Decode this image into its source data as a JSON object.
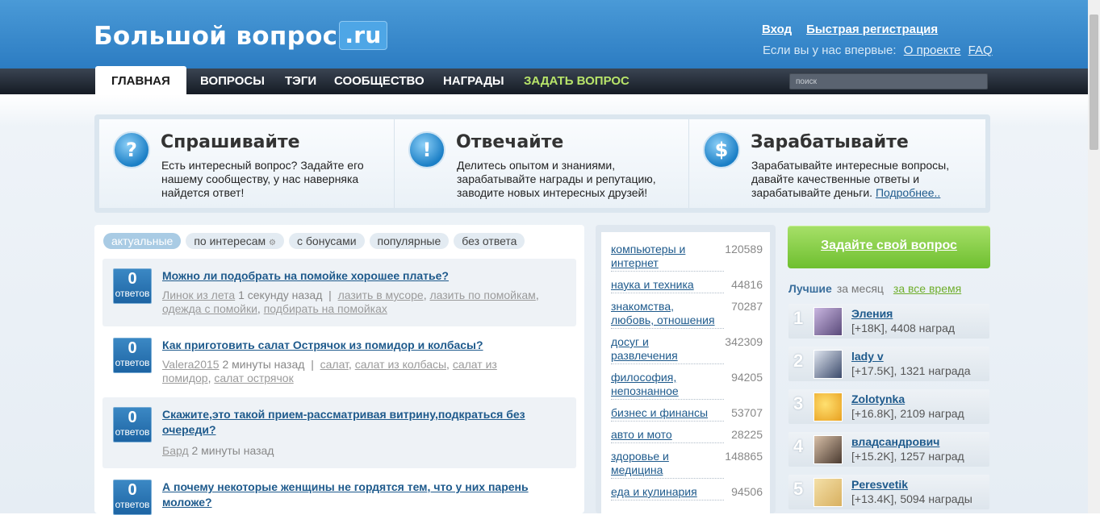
{
  "header": {
    "logo_text": "Большой вопрос",
    "logo_tld": ".ru",
    "login": "Вход",
    "register": "Быстрая регистрация",
    "first_time_text": "Если вы у нас впервые:",
    "about": "О проекте",
    "faq": "FAQ"
  },
  "nav": {
    "items": [
      "ГЛАВНАЯ",
      "ВОПРОСЫ",
      "ТЭГИ",
      "СООБЩЕСТВО",
      "НАГРАДЫ",
      "ЗАДАТЬ ВОПРОС"
    ],
    "search_placeholder": "поиск"
  },
  "promo": [
    {
      "icon": "?",
      "title": "Спрашивайте",
      "lines": [
        "Есть интересный вопрос? Задайте его",
        "нашему сообществу, у нас наверняка",
        "найдется ответ!"
      ]
    },
    {
      "icon": "!",
      "title": "Отвечайте",
      "lines": [
        "Делитесь опытом и знаниями,",
        "зарабатывайте награды и репутацию,",
        "заводите новых интересных друзей!"
      ]
    },
    {
      "icon": "$",
      "title": "Зарабатывайте",
      "lines": [
        "Зарабатывайте интересные вопросы,",
        "давайте качественные ответы и",
        "зарабатывайте деньги."
      ],
      "more": "Подробнее.."
    }
  ],
  "filters": [
    "актуальные",
    "по интересам",
    "с бонусами",
    "популярные",
    "без ответа"
  ],
  "questions": [
    {
      "answers": "0",
      "answers_label": "ответов",
      "title": "Можно ли подобрать на помойке хорошее платье?",
      "meta_line1": {
        "author": "Линок из лета",
        "time": "1 секунду назад",
        "tags": [
          "лазить в мусоре",
          "лазить по помойкам"
        ]
      },
      "meta_line2_tags": [
        "одежда с помойки",
        "подбирать на помойках"
      ]
    },
    {
      "answers": "0",
      "answers_label": "ответов",
      "title": "Как приготовить салат Острячок из помидор и колбасы?",
      "meta_line1": {
        "author": "Valera2015",
        "time": "2 минуты назад",
        "tags": [
          "салат",
          "салат из колбасы",
          "салат из"
        ]
      },
      "meta_line2_tags": [
        "помидор",
        "салат острячок"
      ]
    },
    {
      "answers": "0",
      "answers_label": "ответов",
      "title_line1": "Скажите,это такой прием-рассматривая витрину,подкраться без",
      "title_line2": "очереди?",
      "meta": {
        "author": "Бард",
        "time": "2 минуты назад"
      }
    },
    {
      "answers": "0",
      "answers_label": "ответов",
      "title_line1": "А почему некоторые женщины не гордятся тем, что у них парень",
      "title_line2": "моложе?"
    }
  ],
  "categories": [
    {
      "lines": [
        "компьютеры и",
        "интернет"
      ],
      "count": "120589"
    },
    {
      "lines": [
        "наука и техника"
      ],
      "count": "44816"
    },
    {
      "lines": [
        "знакомства,",
        "любовь, отношения"
      ],
      "count": "70287"
    },
    {
      "lines": [
        "досуг и",
        "развлечения"
      ],
      "count": "342309"
    },
    {
      "lines": [
        "философия,",
        "непознанное"
      ],
      "count": "94205"
    },
    {
      "lines": [
        "бизнес и финансы"
      ],
      "count": "53707"
    },
    {
      "lines": [
        "авто и мото"
      ],
      "count": "28225"
    },
    {
      "lines": [
        "здоровье и",
        "медицина"
      ],
      "count": "148865"
    },
    {
      "lines": [
        "еда и кулинария"
      ],
      "count": "94506"
    }
  ],
  "sidebar": {
    "ask_button": "Задайте свой вопрос",
    "best_label": "Лучшие",
    "period_month": "за месяц",
    "period_all": "за все время",
    "leaders": [
      {
        "rank": "1",
        "name": "Эления",
        "stat": "[+18K], 4408 наград",
        "avatar_color": "#5a4a7a"
      },
      {
        "rank": "2",
        "name": "lady v",
        "stat": "[+17.5K], 1321 награда",
        "avatar_color": "#3b4a6b"
      },
      {
        "rank": "3",
        "name": "Zolotynka",
        "stat": "[+16.8K], 2109 наград",
        "avatar_color": "#e8a020"
      },
      {
        "rank": "4",
        "name": "владсандрович",
        "stat": "[+15.2K], 1257 наград",
        "avatar_color": "#4a3a30"
      },
      {
        "rank": "5",
        "name": "Peresvetik",
        "stat": "[+13.4K], 5094 награды",
        "avatar_color": "#d8b060"
      }
    ]
  }
}
